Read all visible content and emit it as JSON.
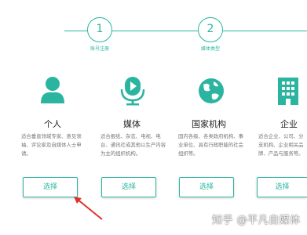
{
  "steps": [
    {
      "number": "1",
      "label": "账号注册"
    },
    {
      "number": "2",
      "label": "媒体类型"
    }
  ],
  "cards": [
    {
      "title": "个人",
      "description": "适合垂直领域专家、意见领袖、评论家及自媒体人士申请。",
      "button": "选择",
      "icon": "person-icon"
    },
    {
      "title": "媒体",
      "description": "适合报纸、杂志、电视、电台、通讯社或其他以生产内容为主的组织机构。",
      "button": "选择",
      "icon": "microphone-icon"
    },
    {
      "title": "国家机构",
      "description": "国内各级、各类政府机构、事业单位、具有行政职能的社会组织等。",
      "button": "选择",
      "icon": "globe-icon"
    },
    {
      "title": "企业",
      "description": "适合企业、公司、分支机构、企业相关品牌、产品与服务等。",
      "button": "选择",
      "icon": "building-icon"
    }
  ],
  "watermark": "知乎 @平凡自媒体",
  "colors": {
    "accent": "#2bb5a0",
    "annotation": "#e03030"
  }
}
